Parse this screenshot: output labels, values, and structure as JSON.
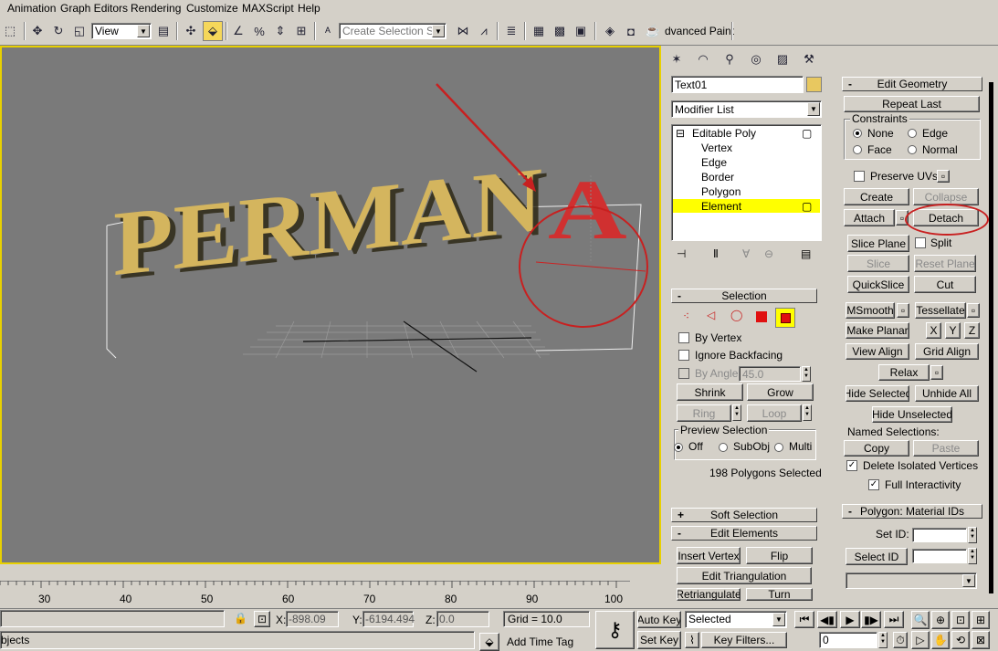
{
  "menu": [
    "Animation",
    "Graph Editors",
    "Rendering",
    "Customize",
    "MAXScript",
    "Help"
  ],
  "toolbar": {
    "view_combo": "View",
    "selection_set_placeholder": "Create Selection Set",
    "paint_label": "dvanced Paint"
  },
  "viewport": {
    "text3d": "PERMAN",
    "highlight_letter": "A"
  },
  "cmd": {
    "object_name": "Text01",
    "object_color": "#e8c860",
    "modifier_list": "Modifier List",
    "stack": [
      "Editable Poly",
      "Vertex",
      "Edge",
      "Border",
      "Polygon",
      "Element"
    ]
  },
  "selection": {
    "header": "Selection",
    "by_vertex": "By Vertex",
    "ignore_backfacing": "Ignore Backfacing",
    "by_angle": "By Angle:",
    "angle_value": "45.0",
    "shrink": "Shrink",
    "grow": "Grow",
    "ring": "Ring",
    "loop": "Loop",
    "preview_title": "Preview Selection",
    "preview_off": "Off",
    "preview_subobj": "SubObj",
    "preview_multi": "Multi",
    "status": "198 Polygons Selected"
  },
  "soft_selection": {
    "header": "Soft Selection"
  },
  "edit_elements": {
    "header": "Edit Elements",
    "insert_vertex": "Insert Vertex",
    "flip": "Flip",
    "edit_triangulation": "Edit Triangulation",
    "retriangulate": "Retriangulate",
    "turn": "Turn"
  },
  "edit_geometry": {
    "header": "Edit Geometry",
    "repeat_last": "Repeat Last",
    "constraints": "Constraints",
    "none": "None",
    "edge": "Edge",
    "face": "Face",
    "normal": "Normal",
    "preserve_uvs": "Preserve UVs",
    "create": "Create",
    "collapse": "Collapse",
    "attach": "Attach",
    "detach": "Detach",
    "slice_plane": "Slice Plane",
    "split": "Split",
    "slice": "Slice",
    "reset_plane": "Reset Plane",
    "quickslice": "QuickSlice",
    "cut": "Cut",
    "msmooth": "MSmooth",
    "tessellate": "Tessellate",
    "make_planar": "Make Planar",
    "x": "X",
    "y": "Y",
    "z": "Z",
    "view_align": "View Align",
    "grid_align": "Grid Align",
    "relax": "Relax",
    "hide_selected": "Hide Selected",
    "unhide_all": "Unhide All",
    "hide_unselected": "Hide Unselected",
    "named_selections": "Named Selections:",
    "copy": "Copy",
    "paste": "Paste",
    "delete_isolated": "Delete Isolated Vertices",
    "full_interactivity": "Full Interactivity"
  },
  "material_ids": {
    "header": "Polygon: Material IDs",
    "set_id": "Set ID:",
    "select_id": "Select ID"
  },
  "timeline": {
    "ticks": [
      "30",
      "40",
      "50",
      "60",
      "70",
      "80",
      "90",
      "100"
    ]
  },
  "status": {
    "x_label": "X:",
    "x_value": "-898.09",
    "y_label": "Y:",
    "y_value": "-6194.494",
    "z_label": "Z:",
    "z_value": "0.0",
    "grid": "Grid = 10.0",
    "auto_key": "Auto Key",
    "set_key": "Set Key",
    "selected": "Selected",
    "key_filters": "Key Filters...",
    "frame": "0",
    "add_time_tag": "Add Time Tag",
    "objects": "bjects"
  },
  "colors": {
    "accent_red": "#c82020",
    "highlight_yellow": "#ffff00",
    "viewport_border": "#e8d000"
  }
}
